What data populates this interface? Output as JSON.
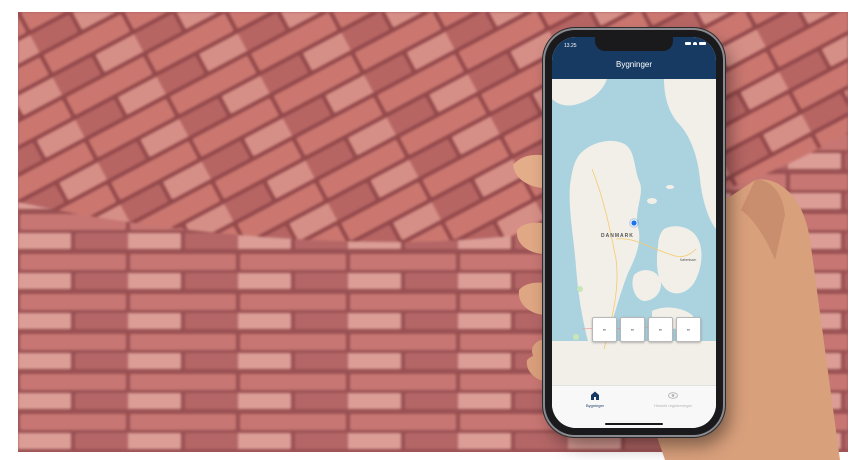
{
  "phone": {
    "status_time": "13.25",
    "nav_title": "Bygninger",
    "map": {
      "country_label": "DANMARK",
      "city_label": "København"
    },
    "tabs": [
      {
        "label": "Bygninger",
        "icon": "building-icon",
        "active": true
      },
      {
        "label": "Historik registreringer",
        "icon": "eye-icon",
        "active": false
      }
    ]
  },
  "colors": {
    "nav_background": "#173a63",
    "water": "#aad3df",
    "land": "#f2efe9",
    "location_dot": "#1a73e8"
  }
}
